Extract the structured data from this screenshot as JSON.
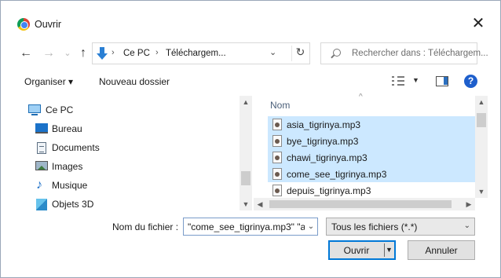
{
  "window": {
    "title": "Ouvrir",
    "close_glyph": "✕",
    "app_icon": "chrome-icon"
  },
  "nav": {
    "back_glyph": "←",
    "forward_glyph": "→",
    "up_glyph": "↑",
    "recent_glyph": "⌄",
    "address": {
      "icon": "download-arrow-icon",
      "crumbs": [
        "Ce PC",
        "Téléchargem..."
      ],
      "separator": "›",
      "dropdown_glyph": "⌄",
      "refresh_glyph": "↻"
    },
    "search": {
      "placeholder": "Rechercher dans : Téléchargem..."
    }
  },
  "toolbar": {
    "organize_label": "Organiser ▾",
    "new_folder_label": "Nouveau dossier",
    "view_dropdown_glyph": "▼",
    "help_glyph": "?"
  },
  "tree": {
    "items": [
      {
        "label": "Ce PC",
        "icon": "pc-icon"
      },
      {
        "label": "Bureau",
        "icon": "desktop-icon"
      },
      {
        "label": "Documents",
        "icon": "documents-icon"
      },
      {
        "label": "Images",
        "icon": "images-icon"
      },
      {
        "label": "Musique",
        "icon": "music-icon"
      },
      {
        "label": "Objets 3D",
        "icon": "objects-3d-icon"
      }
    ]
  },
  "files": {
    "column_header": "Nom",
    "sort_glyph": "^",
    "rows": [
      {
        "name": "asia_tigrinya.mp3",
        "selected": true
      },
      {
        "name": "bye_tigrinya.mp3",
        "selected": true
      },
      {
        "name": "chawi_tigrinya.mp3",
        "selected": true
      },
      {
        "name": "come_see_tigrinya.mp3",
        "selected": true
      },
      {
        "name": "depuis_tigrinya.mp3",
        "selected": false
      }
    ]
  },
  "scroll": {
    "up_glyph": "▲",
    "down_glyph": "▼",
    "left_glyph": "◀",
    "right_glyph": "▶"
  },
  "footer": {
    "filename_label": "Nom du fichier :",
    "filename_value": "\"come_see_tigrinya.mp3\" \"a",
    "filename_dropdown_glyph": "⌄",
    "filetype_value": "Tous les fichiers (*.*)",
    "filetype_dropdown_glyph": "⌄",
    "open_label": "Ouvrir",
    "open_split_glyph": "▼",
    "cancel_label": "Annuler"
  },
  "colors": {
    "selection": "#cce8ff",
    "accent": "#0078d7",
    "help": "#1e5fcc"
  }
}
